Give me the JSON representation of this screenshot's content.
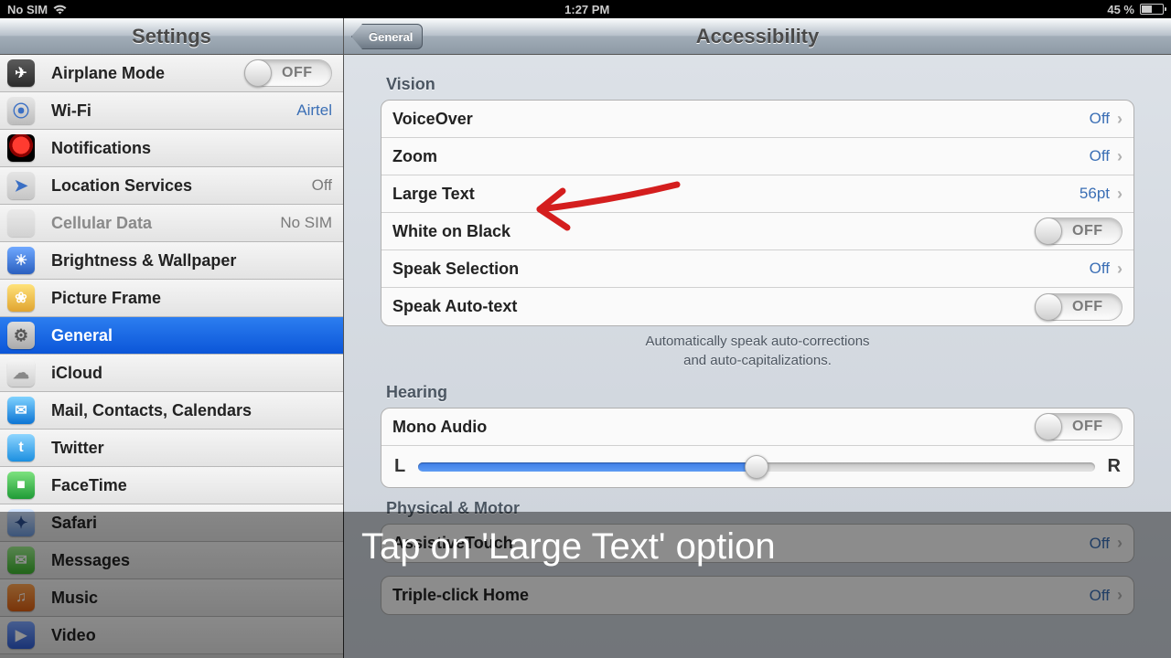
{
  "status": {
    "carrier": "No SIM",
    "time": "1:27 PM",
    "battery": "45 %"
  },
  "sidebar": {
    "title": "Settings",
    "items": [
      {
        "label": "Airplane Mode",
        "value": "OFF",
        "type": "toggle"
      },
      {
        "label": "Wi-Fi",
        "value": "Airtel",
        "type": "link"
      },
      {
        "label": "Notifications",
        "type": "link"
      },
      {
        "label": "Location Services",
        "value": "Off",
        "type": "link"
      },
      {
        "label": "Cellular Data",
        "value": "No SIM",
        "type": "disabled"
      },
      {
        "label": "Brightness & Wallpaper",
        "type": "link"
      },
      {
        "label": "Picture Frame",
        "type": "link"
      },
      {
        "label": "General",
        "type": "selected"
      },
      {
        "label": "iCloud",
        "type": "link"
      },
      {
        "label": "Mail, Contacts, Calendars",
        "type": "link"
      },
      {
        "label": "Twitter",
        "type": "link"
      },
      {
        "label": "FaceTime",
        "type": "link"
      },
      {
        "label": "Safari",
        "type": "link"
      },
      {
        "label": "Messages",
        "type": "link"
      },
      {
        "label": "Music",
        "type": "link"
      },
      {
        "label": "Video",
        "type": "link"
      }
    ]
  },
  "detail": {
    "back": "General",
    "title": "Accessibility",
    "vision": {
      "header": "Vision",
      "voiceover": {
        "label": "VoiceOver",
        "value": "Off"
      },
      "zoom": {
        "label": "Zoom",
        "value": "Off"
      },
      "largetext": {
        "label": "Large Text",
        "value": "56pt"
      },
      "whiteonblack": {
        "label": "White on Black",
        "value": "OFF"
      },
      "speaksel": {
        "label": "Speak Selection",
        "value": "Off"
      },
      "speakauto": {
        "label": "Speak Auto-text",
        "value": "OFF"
      },
      "note1": "Automatically speak auto-corrections",
      "note2": "and auto-capitalizations."
    },
    "hearing": {
      "header": "Hearing",
      "mono": {
        "label": "Mono Audio",
        "value": "OFF"
      },
      "L": "L",
      "R": "R"
    },
    "physical": {
      "header": "Physical & Motor",
      "assistive": {
        "label": "AssistiveTouch",
        "value": "Off"
      },
      "triple": {
        "label": "Triple-click Home",
        "value": "Off"
      }
    }
  },
  "annotation": {
    "caption": "Tap on 'Large Text' option"
  }
}
